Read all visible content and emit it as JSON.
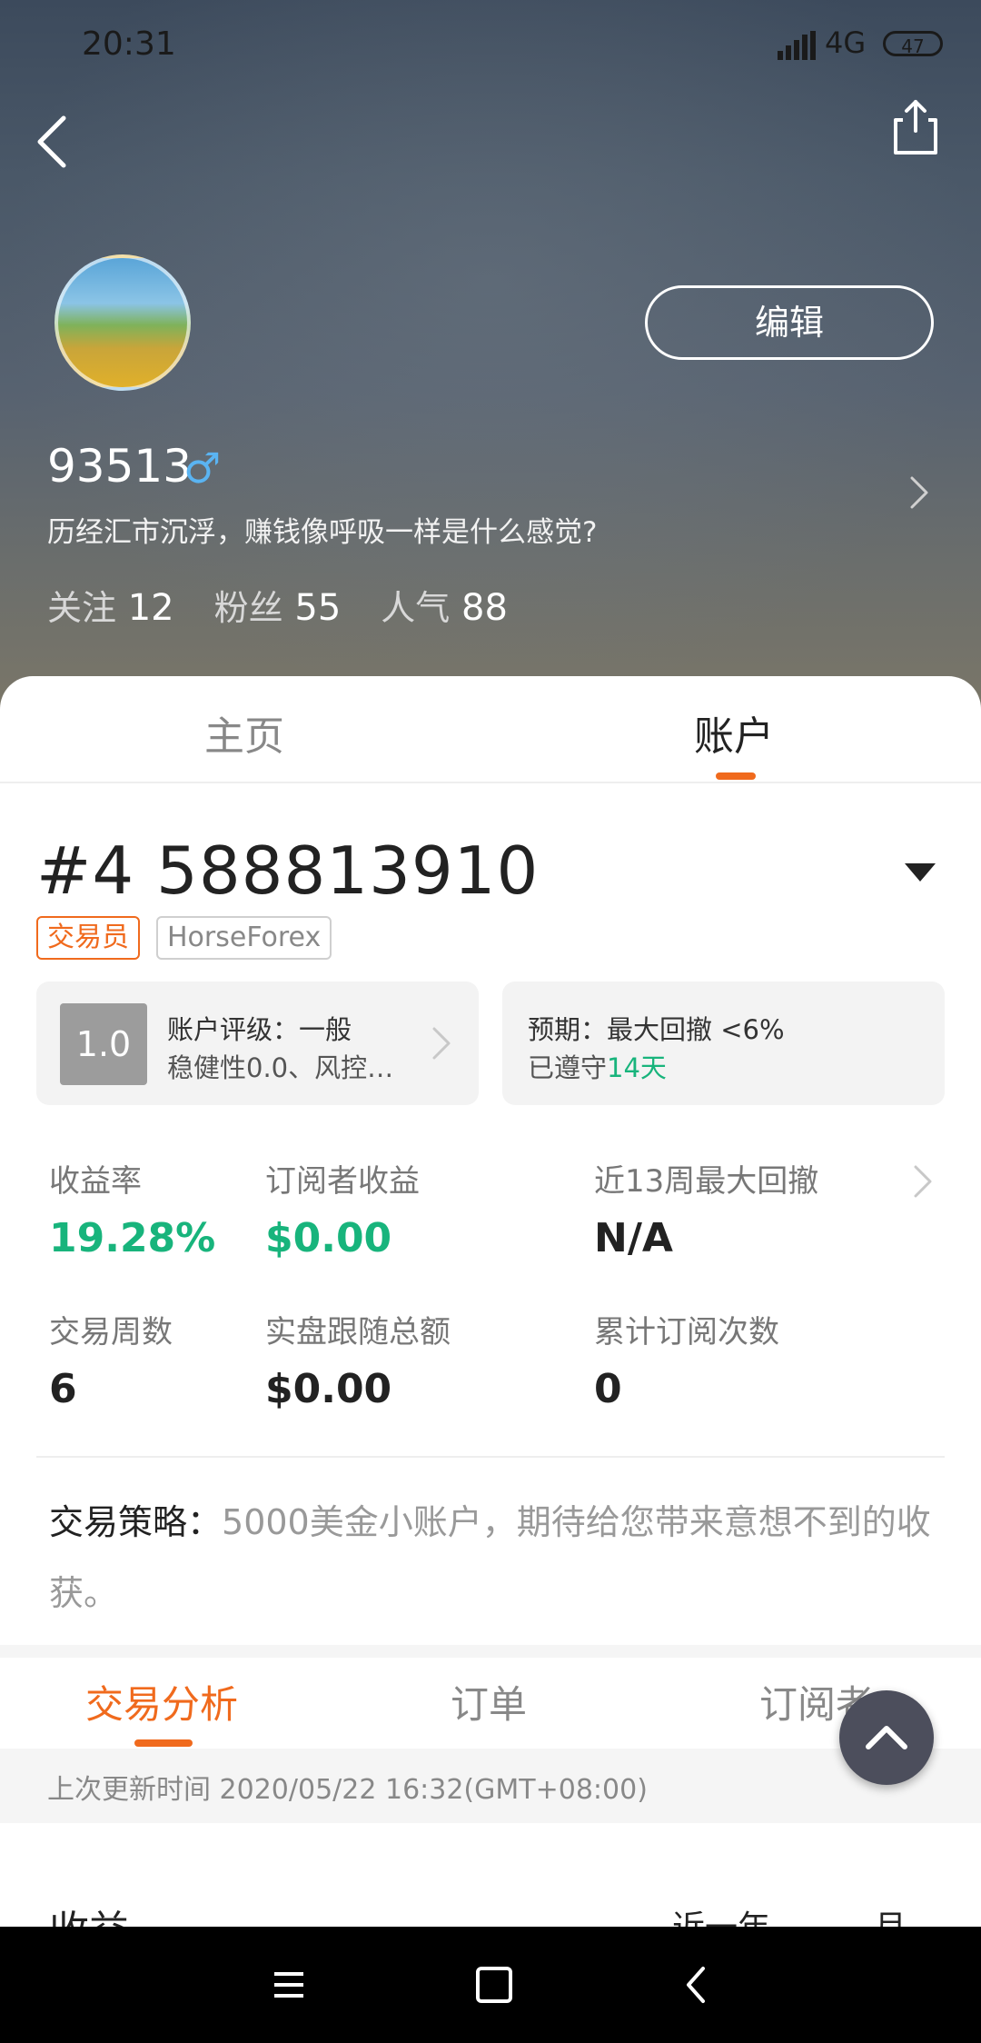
{
  "status_bar": {
    "time": "20:31",
    "network": "4G",
    "battery": "47"
  },
  "profile": {
    "edit_label": "编辑",
    "name": "93513",
    "gender_symbol": "♂",
    "bio": "历经汇市沉浮，赚钱像呼吸一样是什么感觉?",
    "stats": [
      {
        "label": "关注",
        "value": "12"
      },
      {
        "label": "粉丝",
        "value": "55"
      },
      {
        "label": "人气",
        "value": "88"
      }
    ]
  },
  "tabs": {
    "home": "主页",
    "account": "账户",
    "active": "account"
  },
  "account": {
    "id": "#4 588813910",
    "tags": {
      "role": "交易员",
      "broker": "HorseForex"
    },
    "rating": {
      "score": "1.0",
      "line1": "账户评级：一般",
      "line2": "稳健性0.0、风控…"
    },
    "expectation": {
      "line1": "预期：最大回撤 <6%",
      "line2_prefix": "已遵守",
      "line2_days": "14天"
    },
    "metrics": [
      {
        "label": "收益率",
        "value": "19.28%"
      },
      {
        "label": "订阅者收益",
        "value": "$0.00"
      },
      {
        "label": "近13周最大回撤",
        "value": "N/A"
      },
      {
        "label": "交易周数",
        "value": "6"
      },
      {
        "label": "实盘跟随总额",
        "value": "$0.00"
      },
      {
        "label": "累计订阅次数",
        "value": "0"
      }
    ],
    "strategy_label": "交易策略：",
    "strategy_text": "5000美金小账户，期待给您带来意想不到的收获。"
  },
  "subtabs": {
    "analysis": "交易分析",
    "orders": "订单",
    "subscribers": "订阅者",
    "active": "analysis"
  },
  "updated_text": "上次更新时间 2020/05/22 16:32(GMT+08:00)",
  "income": {
    "title": "收益",
    "filter_period": "近一年 ⌄",
    "filter_unit": "月 ⌄"
  },
  "colors": {
    "accent": "#f06a1d",
    "positive": "#18b47c",
    "gender": "#5ab4f2"
  }
}
